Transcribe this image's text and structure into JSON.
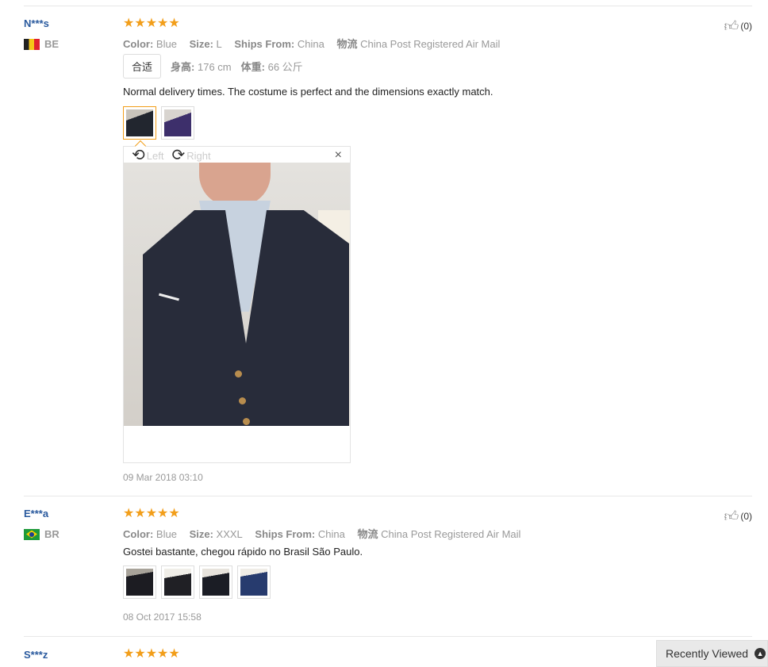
{
  "reviews": [
    {
      "user": "N***s",
      "country": "BE",
      "stars": "★★★★★",
      "color_label": "Color:",
      "color_value": "Blue",
      "size_label": "Size:",
      "size_value": "L",
      "ships_label": "Ships From:",
      "ships_value": "China",
      "logistics_label": "物流",
      "logistics_value": "China Post Registered Air Mail",
      "fit": "合适",
      "height_label": "身高:",
      "height_value": "176 cm",
      "weight_label": "体重:",
      "weight_value": "66 公斤",
      "text": "Normal delivery times. The costume is perfect and the dimensions exactly match.",
      "date": "09 Mar 2018 03:10",
      "likes": "(0)"
    },
    {
      "user": "E***a",
      "country": "BR",
      "stars": "★★★★★",
      "color_label": "Color:",
      "color_value": "Blue",
      "size_label": "Size:",
      "size_value": "XXXL",
      "ships_label": "Ships From:",
      "ships_value": "China",
      "logistics_label": "物流",
      "logistics_value": "China Post Registered Air Mail",
      "text": "Gostei bastante, chegou rápido no Brasil São Paulo.",
      "date": "08 Oct 2017 15:58",
      "likes": "(0)"
    },
    {
      "user": "S***z",
      "stars": "★★★★★"
    }
  ],
  "viewer": {
    "rotate_left": "Left",
    "rotate_right": "Right",
    "close": "×"
  },
  "recently_viewed": "Recently Viewed",
  "icons": {
    "thumbs_up": "thumbs-up-icon",
    "rotate_left": "rotate-left-icon",
    "rotate_right": "rotate-right-icon",
    "close": "close-icon",
    "chevron_up": "chevron-up-icon"
  },
  "colors": {
    "username": "#2a5a9e",
    "stars": "#f29e1a",
    "muted": "#999999"
  }
}
